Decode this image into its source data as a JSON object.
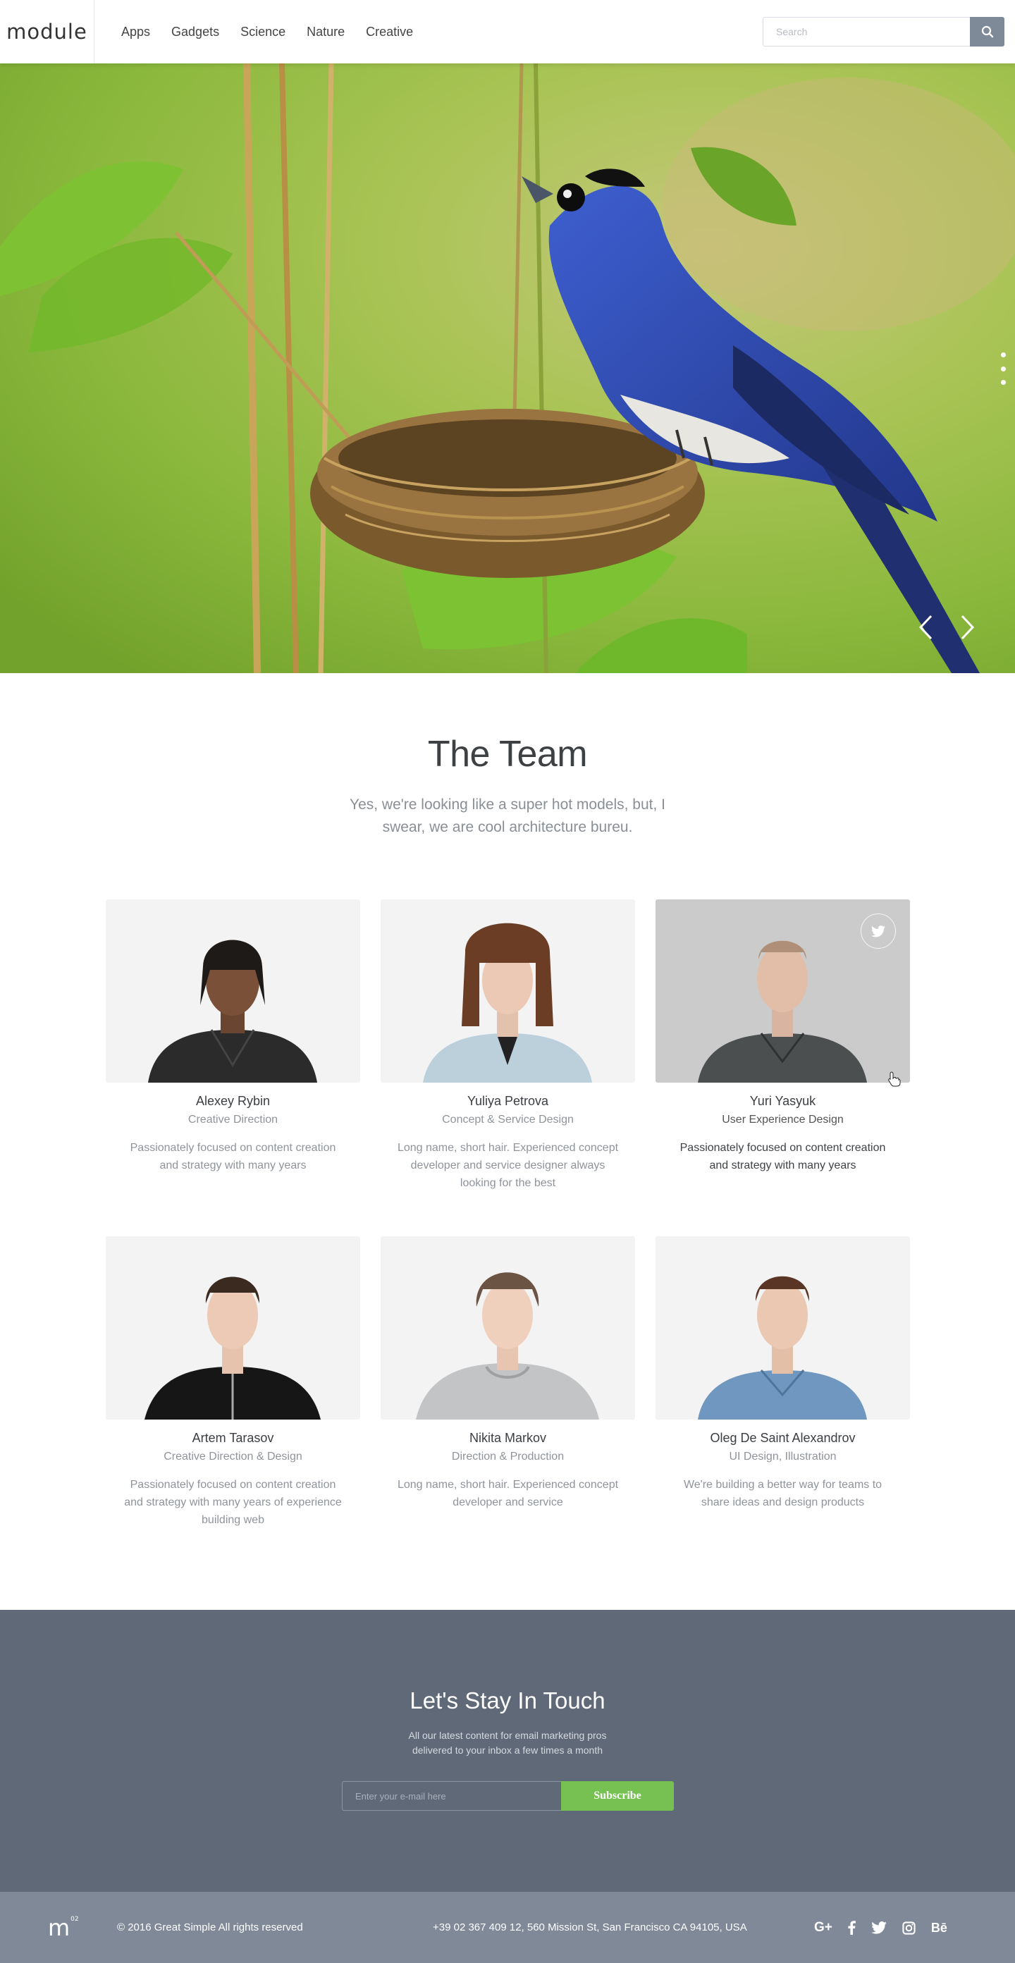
{
  "header": {
    "logo": "module",
    "nav": [
      "Apps",
      "Gadgets",
      "Science",
      "Nature",
      "Creative"
    ],
    "search_placeholder": "Search"
  },
  "hero": {
    "slide_count_dots": 3
  },
  "team": {
    "title": "The Team",
    "subtitle": "Yes, we're looking like a super hot models, but, I swear, we are cool architecture bureu.",
    "members": [
      {
        "name": "Alexey Rybin",
        "role": "Creative Direction",
        "bio": "Passionately focused on content creation and strategy with many years"
      },
      {
        "name": "Yuliya Petrova",
        "role": "Concept & Service Design",
        "bio": "Long name, short hair. Experienced concept developer and service designer always looking for the best"
      },
      {
        "name": "Yuri Yasyuk",
        "role": "User Experience Design",
        "bio": "Passionately focused on content creation and strategy with many years"
      },
      {
        "name": "Artem Tarasov",
        "role": "Creative Direction & Design",
        "bio": "Passionately focused on content creation and strategy with many years of experience building web"
      },
      {
        "name": "Nikita Markov",
        "role": "Direction & Production",
        "bio": "Long name, short hair. Experienced concept developer and service"
      },
      {
        "name": "Oleg De Saint Alexandrov",
        "role": "UI Design, Illustration",
        "bio": "We're building a better way for teams to share ideas and design products"
      }
    ]
  },
  "newsletter": {
    "title": "Let's Stay In Touch",
    "subtitle": "All our latest content for email marketing pros delivered to your inbox a few times a month",
    "email_placeholder": "Enter your e-mail here",
    "button": "Subscribe"
  },
  "footer": {
    "logo": "m",
    "logo_sup": "02",
    "copyright": "© 2016 Great Simple All rights reserved",
    "address": "+39 02 367 409 12, 560 Mission St, San Francisco CA 94105, USA",
    "social_icons": [
      "google-plus-icon",
      "facebook-icon",
      "twitter-icon",
      "instagram-icon",
      "behance-icon"
    ],
    "google_plus_text": "G+",
    "behance_text": "Bē"
  },
  "colors": {
    "newsletter_bg": "#5f6978",
    "footer_bg": "#7f8998",
    "subscribe_green": "#76c151",
    "search_button": "#7f8a99"
  }
}
